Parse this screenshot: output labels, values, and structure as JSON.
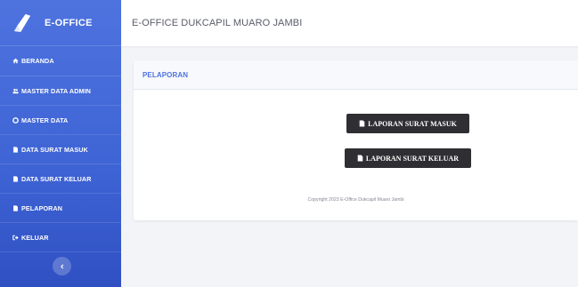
{
  "brand": {
    "name": "E-OFFICE",
    "logo_icon": "paper-plane-logo-icon"
  },
  "sidebar": {
    "items": [
      {
        "label": "BERANDA",
        "icon": "home-icon"
      },
      {
        "label": "MASTER DATA ADMIN",
        "icon": "users-icon"
      },
      {
        "label": "MASTER DATA",
        "icon": "circle-icon"
      },
      {
        "label": "DATA SURAT MASUK",
        "icon": "file-icon"
      },
      {
        "label": "DATA SURAT KELUAR",
        "icon": "file-icon"
      },
      {
        "label": "PELAPORAN",
        "icon": "file-icon"
      },
      {
        "label": "KELUAR",
        "icon": "sign-out-icon"
      }
    ],
    "toggle_icon": "chevron-left-icon"
  },
  "topbar": {
    "title": "E-OFFICE DUKCAPIL MUARO JAMBI"
  },
  "card": {
    "title": "PELAPORAN",
    "buttons": [
      {
        "label": "LAPORAN SURAT MASUK",
        "icon": "file-icon"
      },
      {
        "label": "LAPORAN SURAT KELUAR",
        "icon": "file-icon"
      }
    ],
    "copyright": "Copyright 2023 E-Office Dukcapil Muaro Jambi"
  },
  "colors": {
    "sidebar": "#4e73df",
    "button": "#2f2f33",
    "accent": "#4e73df",
    "background": "#f3f4f8"
  }
}
